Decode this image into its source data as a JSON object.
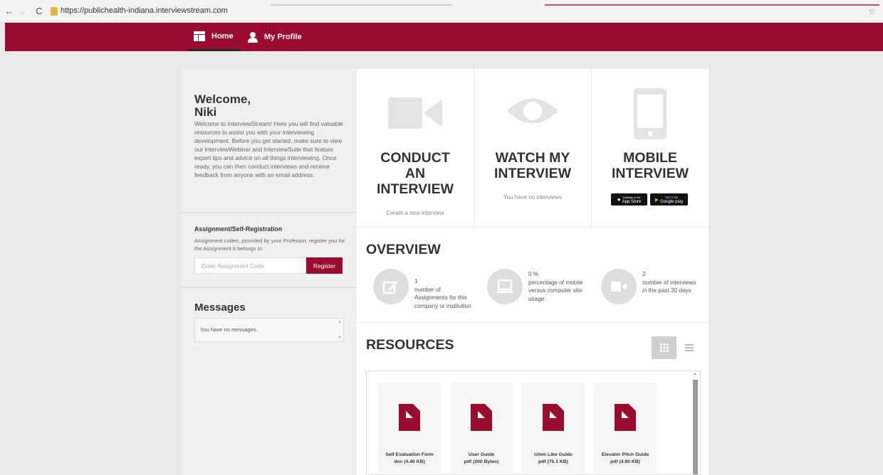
{
  "browser": {
    "url": "https://publichealth-indiana.interviewstream.com"
  },
  "nav": {
    "home": "Home",
    "profile": "My Profile"
  },
  "sidebar": {
    "welcome_line1": "Welcome,",
    "welcome_line2": "Niki",
    "welcome_text": "Welcome to InterviewStream! Here you will find valuable resources to assist you with your interviewing development. Before you get started, make sure to view our InterviewWebinar and InterviewSuite that feature expert tips and advice on all things interviewing. Once ready, you can then conduct interviews and receive feedback from anyone with an email address.",
    "assignment_title": "Assignment/Self-Registration",
    "assignment_text": "Assignment codes, provided by your Professor, register you for the Assignment it belongs to.",
    "code_placeholder": "Enter Assignment Code",
    "register_label": "Register",
    "messages_title": "Messages",
    "messages_empty": "You have no messages."
  },
  "cards": [
    {
      "title_lines": [
        "CONDUCT",
        "AN",
        "INTERVIEW"
      ],
      "sub": "Create a new interview",
      "icon": "video-camera-icon"
    },
    {
      "title_lines": [
        "WATCH MY",
        "INTERVIEW"
      ],
      "sub": "You have no interviews",
      "icon": "eye-icon"
    },
    {
      "title_lines": [
        "MOBILE",
        "INTERVIEW"
      ],
      "sub": "",
      "icon": "phone-icon"
    }
  ],
  "badges": {
    "appstore_small": "Available on the",
    "appstore": "App Store",
    "googleplay_small": "GET IT ON",
    "googleplay": "Google play"
  },
  "overview": {
    "title": "OVERVIEW",
    "stats": [
      {
        "value": "1",
        "label": "number of Assignments for this company or institution",
        "icon": "edit-icon"
      },
      {
        "value": "0 %",
        "label": "percentage of mobile versus computer site usage",
        "icon": "monitor-icon"
      },
      {
        "value": "2",
        "label": "number of interviews in the past 30 days",
        "icon": "video-camera-icon"
      }
    ]
  },
  "resources": {
    "title": "RESOURCES",
    "items": [
      {
        "name": "Self Evaluation Form",
        "meta": "doc (4.40 KB)"
      },
      {
        "name": "User Guide",
        "meta": "pdf (200 Bytes)"
      },
      {
        "name": "Umm Like Guide",
        "meta": "pdf (75.1 KB)"
      },
      {
        "name": "Elevator Pitch Guide",
        "meta": "pdf (4.90 KB)"
      }
    ]
  },
  "colors": {
    "brand": "#9b0c2f",
    "icon_gray": "#e3e3e3"
  }
}
